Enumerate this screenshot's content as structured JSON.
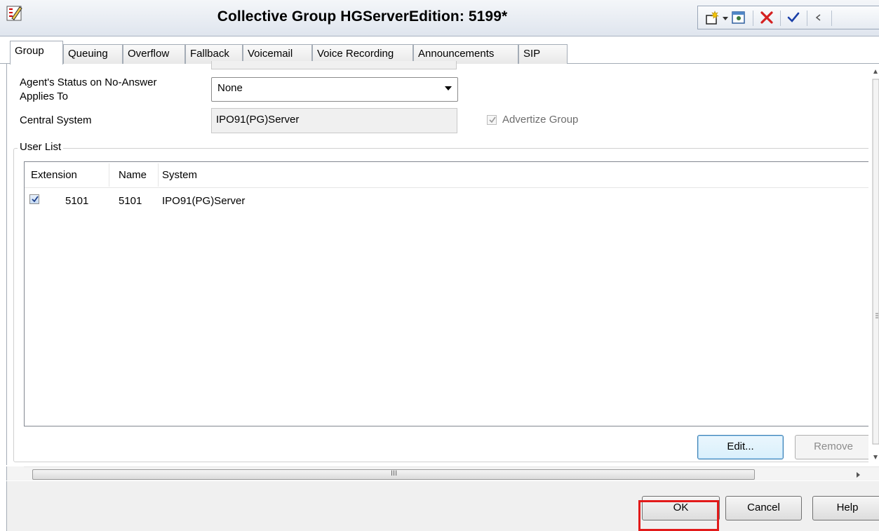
{
  "window": {
    "title": "Collective Group HGServerEdition: 5199*"
  },
  "tabs": [
    {
      "label": "Group",
      "active": true
    },
    {
      "label": "Queuing"
    },
    {
      "label": "Overflow"
    },
    {
      "label": "Fallback"
    },
    {
      "label": "Voicemail"
    },
    {
      "label": "Voice Recording"
    },
    {
      "label": "Announcements"
    },
    {
      "label": "SIP"
    }
  ],
  "form": {
    "agent_status_label": "Agent's Status on No-Answer Applies To",
    "agent_status_label_line1": "Agent's Status on No-Answer",
    "agent_status_label_line2": "Applies To",
    "agent_status_value": "None",
    "central_system_label": "Central System",
    "central_system_value": "IPO91(PG)Server",
    "advertize_group_label": "Advertize Group",
    "advertize_group_checked": true
  },
  "user_list": {
    "group_label": "User List",
    "columns": [
      "Extension",
      "Name",
      "System"
    ],
    "rows": [
      {
        "checked": true,
        "extension": "5101",
        "name": "5101",
        "system": "IPO91(PG)Server"
      }
    ],
    "edit_button": "Edit...",
    "remove_button": "Remove"
  },
  "scrollbar": {
    "grip": "III"
  },
  "footer": {
    "ok": "OK",
    "cancel": "Cancel",
    "help": "Help"
  },
  "icons": {
    "app": "collective-group-icon",
    "new": "new-item-icon",
    "dropdown": "dropdown-arrow-icon",
    "export": "export-icon",
    "delete": "delete-icon",
    "validate": "validate-icon",
    "previous": "previous-icon"
  },
  "colors": {
    "highlight": "#e21a1a"
  }
}
